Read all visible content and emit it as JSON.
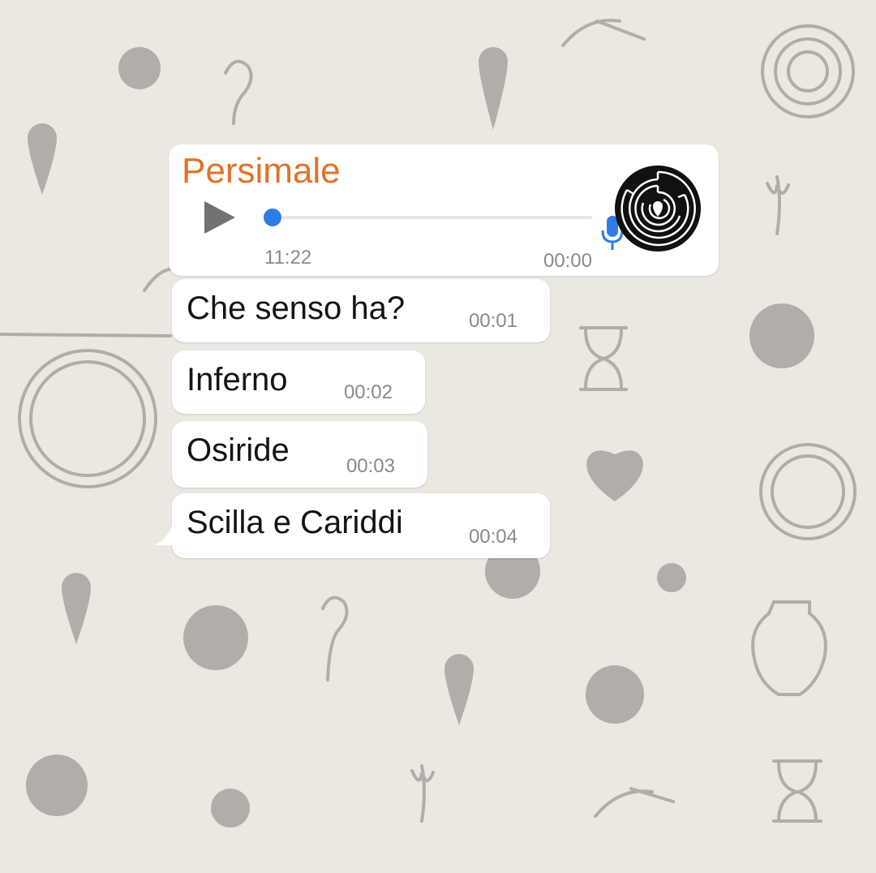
{
  "chat": {
    "voice_message": {
      "sender": "Persimale",
      "duration": "11:22",
      "time": "00:00"
    },
    "messages": [
      {
        "text": "Che senso ha?",
        "time": "00:01"
      },
      {
        "text": "Inferno",
        "time": "00:02"
      },
      {
        "text": "Osiride",
        "time": "00:03"
      },
      {
        "text": "Scilla e Cariddi",
        "time": "00:04"
      }
    ]
  },
  "theme": {
    "background": "#ebe7e1",
    "sender_color": "#e0722b",
    "accent": "#2f7ce4"
  },
  "icons": [
    "play-icon",
    "microphone-icon",
    "maze-avatar",
    "wallpaper-doodles"
  ]
}
